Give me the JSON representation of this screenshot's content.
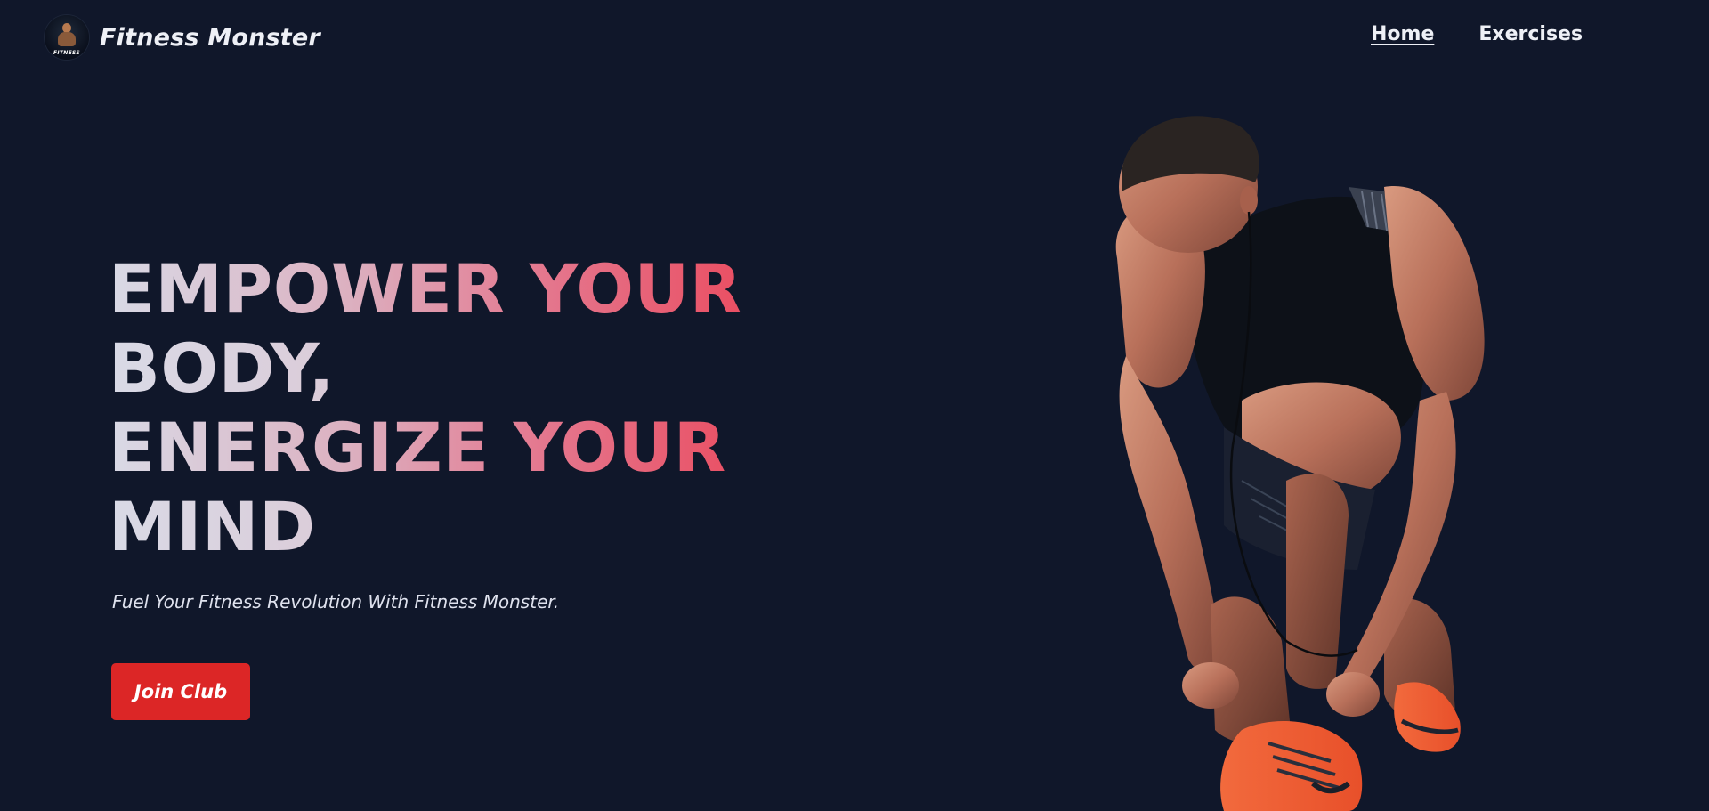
{
  "brand": {
    "name": "Fitness Monster",
    "logo_text": "FITNESS",
    "logo_icon": "bodybuilder-logo-icon"
  },
  "nav": {
    "links": [
      {
        "label": "Home",
        "active": true
      },
      {
        "label": "Exercises",
        "active": false
      }
    ]
  },
  "hero": {
    "title_lines": [
      [
        "EMPOWER ",
        "YOUR"
      ],
      [
        "BODY,"
      ],
      [
        "ENERGIZE ",
        "YOUR"
      ],
      [
        "MIND"
      ]
    ],
    "subtitle": "Fuel Your Fitness Revolution With Fitness Monster.",
    "cta_label": "Join Club",
    "image": "athlete-tying-shoe-illustration"
  },
  "colors": {
    "background": "#10172a",
    "text": "#eef0f6",
    "gradient_start": "#d9dae6",
    "gradient_end": "#ea4f63",
    "cta": "#dc2626"
  }
}
